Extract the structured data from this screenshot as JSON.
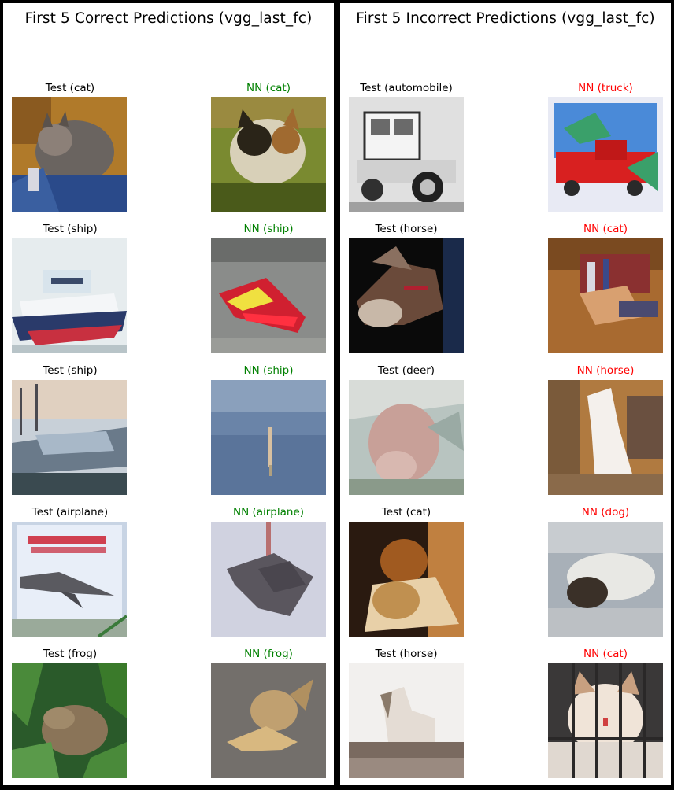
{
  "left_panel": {
    "title": "First 5 Correct Predictions (vgg_last_fc)",
    "rows": [
      {
        "test_label": "Test (cat)",
        "nn_label": "NN (cat)"
      },
      {
        "test_label": "Test (ship)",
        "nn_label": "NN (ship)"
      },
      {
        "test_label": "Test (ship)",
        "nn_label": "NN (ship)"
      },
      {
        "test_label": "Test (airplane)",
        "nn_label": "NN (airplane)"
      },
      {
        "test_label": "Test (frog)",
        "nn_label": "NN (frog)"
      }
    ]
  },
  "right_panel": {
    "title": "First 5 Incorrect Predictions (vgg_last_fc)",
    "rows": [
      {
        "test_label": "Test (automobile)",
        "nn_label": "NN (truck)"
      },
      {
        "test_label": "Test (horse)",
        "nn_label": "NN (cat)"
      },
      {
        "test_label": "Test (deer)",
        "nn_label": "NN (horse)"
      },
      {
        "test_label": "Test (cat)",
        "nn_label": "NN (dog)"
      },
      {
        "test_label": "Test (horse)",
        "nn_label": "NN (cat)"
      }
    ]
  },
  "colors": {
    "correct_nn_label": "#008000",
    "incorrect_nn_label": "#ff0000",
    "test_label": "#000000",
    "background": "#000000",
    "panel": "#ffffff"
  }
}
